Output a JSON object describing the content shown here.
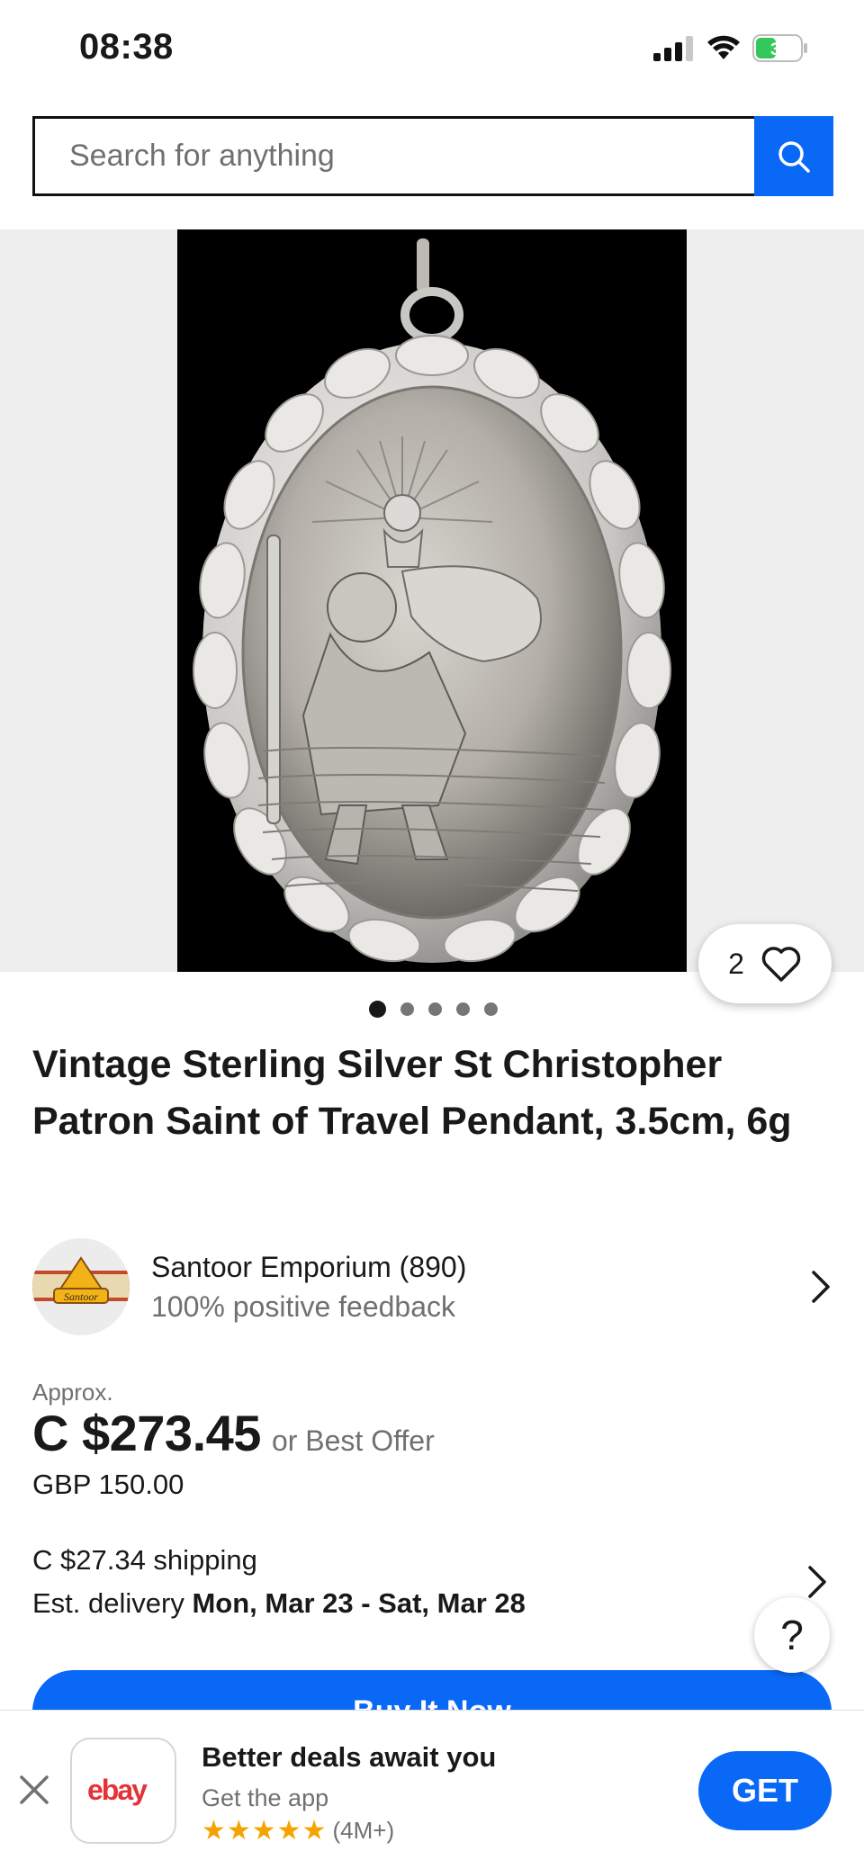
{
  "status_bar": {
    "time": "08:38",
    "battery": "37"
  },
  "search": {
    "placeholder": "Search for anything"
  },
  "gallery": {
    "image_count": 5,
    "active_index": 0,
    "watch_count": "2"
  },
  "listing": {
    "title": "Vintage Sterling Silver St Christopher Patron Saint of Travel Pendant, 3.5cm, 6g"
  },
  "seller": {
    "name": "Santoor Emporium (890)",
    "feedback": "100% positive feedback",
    "logo_text": "Santoor"
  },
  "price": {
    "approx_label": "Approx.",
    "amount": "C $273.45",
    "best_offer": "or Best Offer",
    "original": "GBP 150.00"
  },
  "shipping": {
    "cost": "C $27.34 shipping",
    "delivery_label": "Est. delivery",
    "delivery_dates": "Mon, Mar 23 - Sat, Mar 28"
  },
  "help": {
    "label": "?"
  },
  "buy_button": {
    "label": "Buy It Now"
  },
  "app_banner": {
    "title": "Better deals await you",
    "subtitle": "Get the app",
    "stars": "★★★★★",
    "rating_count": "(4M+)",
    "get_label": "GET",
    "logo_text": "ebay"
  },
  "colors": {
    "accent_blue": "#0968f6",
    "text_primary": "#191919",
    "text_secondary": "#707070",
    "star_gold": "#f5a300"
  }
}
